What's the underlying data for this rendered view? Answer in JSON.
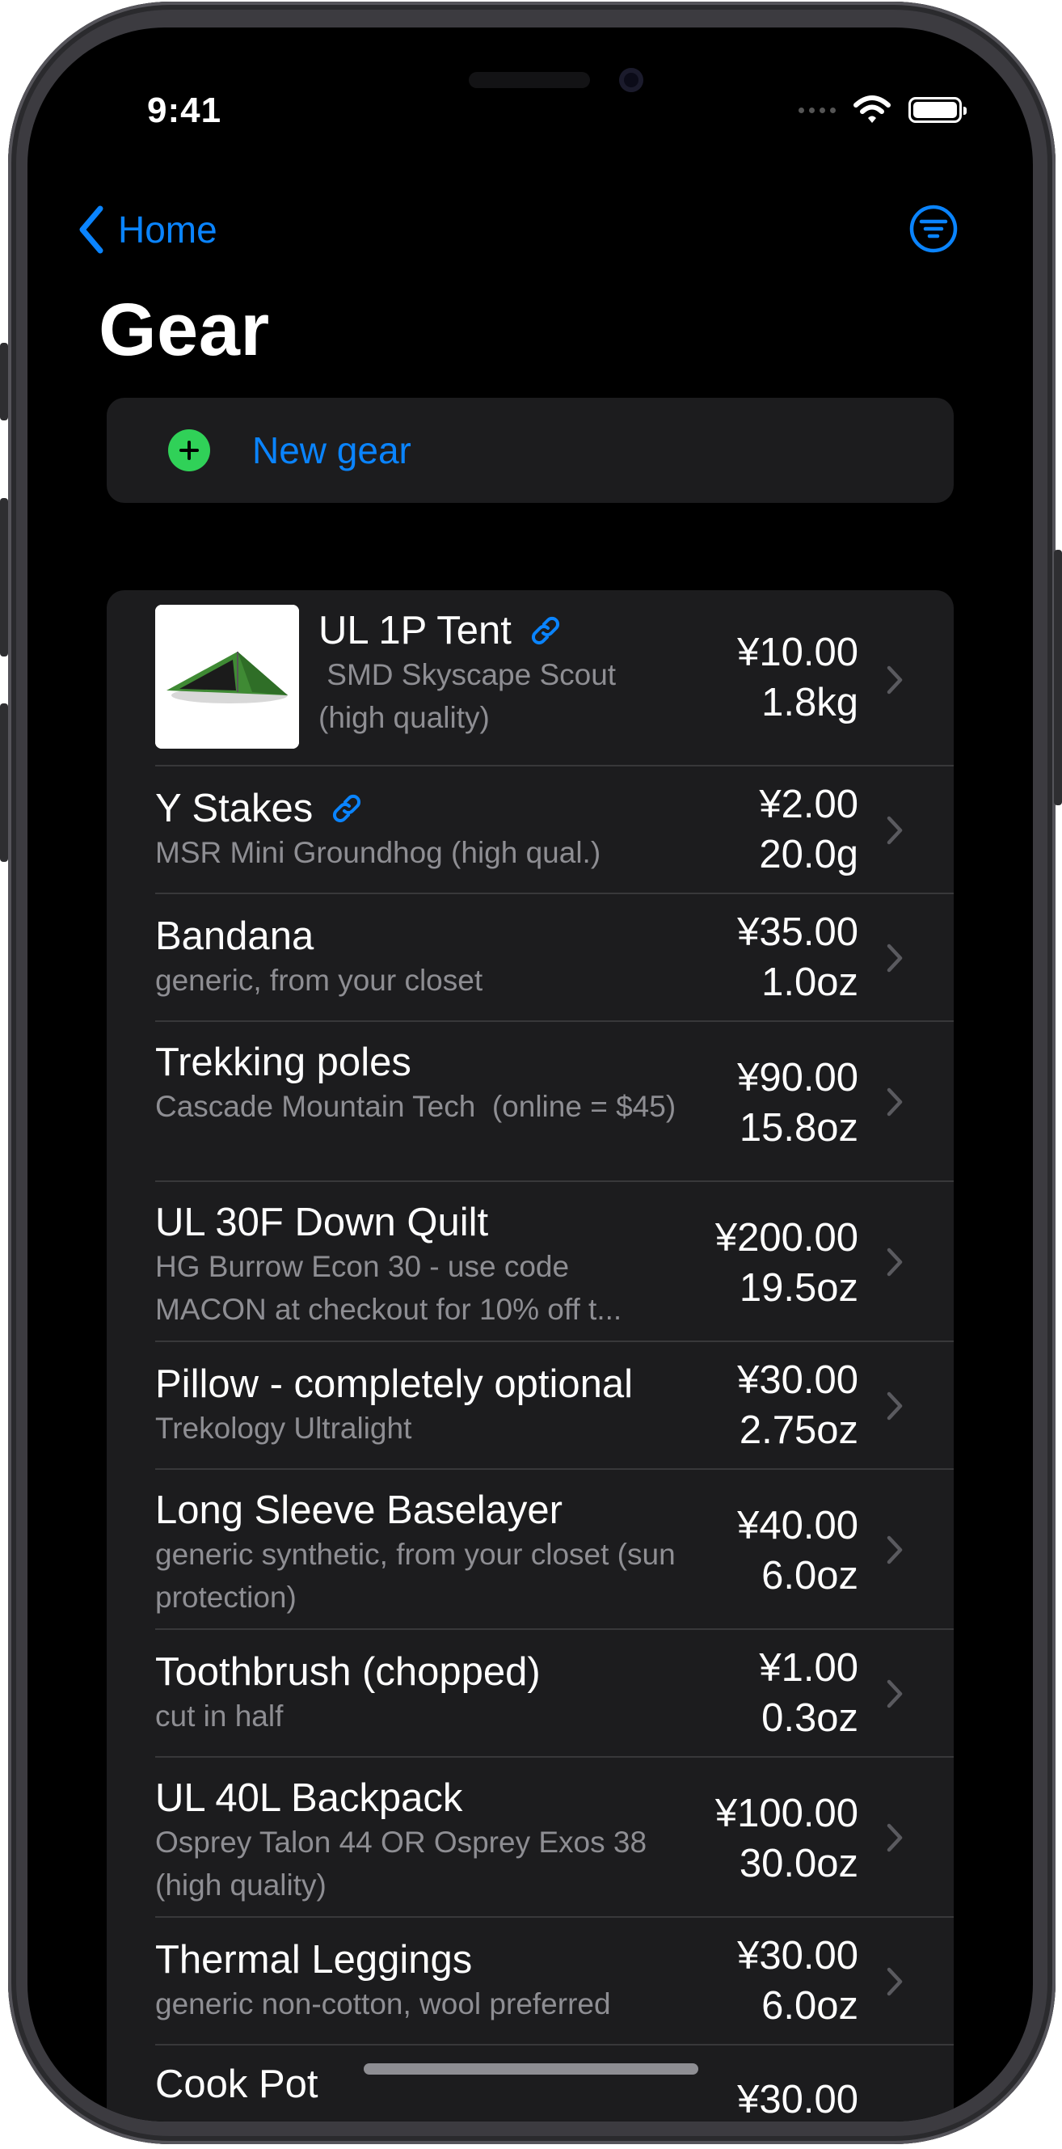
{
  "status_bar": {
    "time": "9:41"
  },
  "nav": {
    "back_label": "Home",
    "filter_icon": "filter-circle-icon"
  },
  "title": "Gear",
  "new_gear": {
    "label": "New gear"
  },
  "colors": {
    "accent": "#0a84ff",
    "add": "#30d158",
    "background": "#000000",
    "cell": "#1c1c1e",
    "secondary_text": "#8e8e93"
  },
  "items": [
    {
      "name": "UL 1P Tent",
      "desc": " SMD Skyscape Scout (high quality)",
      "price": "¥10.00",
      "weight": "1.8kg",
      "has_link": true,
      "has_thumbnail": true
    },
    {
      "name": "Y Stakes",
      "desc": "MSR Mini Groundhog (high qual.)",
      "price": "¥2.00",
      "weight": "20.0g",
      "has_link": true
    },
    {
      "name": "Bandana",
      "desc": "generic, from your closet",
      "price": "¥35.00",
      "weight": "1.0oz"
    },
    {
      "name": "Trekking poles",
      "desc": "Cascade Mountain Tech  (online = $45)",
      "price": "¥90.00",
      "weight": "15.8oz"
    },
    {
      "name": "UL 30F Down Quilt",
      "desc": "HG Burrow Econ 30 - use code MACON at checkout for 10% off t...",
      "price": "¥200.00",
      "weight": "19.5oz"
    },
    {
      "name": "Pillow - completely optional",
      "desc": "Trekology Ultralight",
      "price": "¥30.00",
      "weight": "2.75oz"
    },
    {
      "name": "Long Sleeve Baselayer",
      "desc": "generic synthetic, from your closet (sun protection)",
      "price": "¥40.00",
      "weight": "6.0oz"
    },
    {
      "name": "Toothbrush (chopped)",
      "desc": "cut in half",
      "price": "¥1.00",
      "weight": "0.3oz"
    },
    {
      "name": "UL 40L Backpack",
      "desc": "Osprey Talon 44 OR Osprey Exos 38 (high quality)",
      "price": "¥100.00",
      "weight": "30.0oz"
    },
    {
      "name": "Thermal Leggings",
      "desc": "generic non-cotton, wool preferred",
      "price": "¥30.00",
      "weight": "6.0oz"
    },
    {
      "name": "Cook Pot",
      "desc": "",
      "price": "¥30.00",
      "weight": ""
    }
  ]
}
